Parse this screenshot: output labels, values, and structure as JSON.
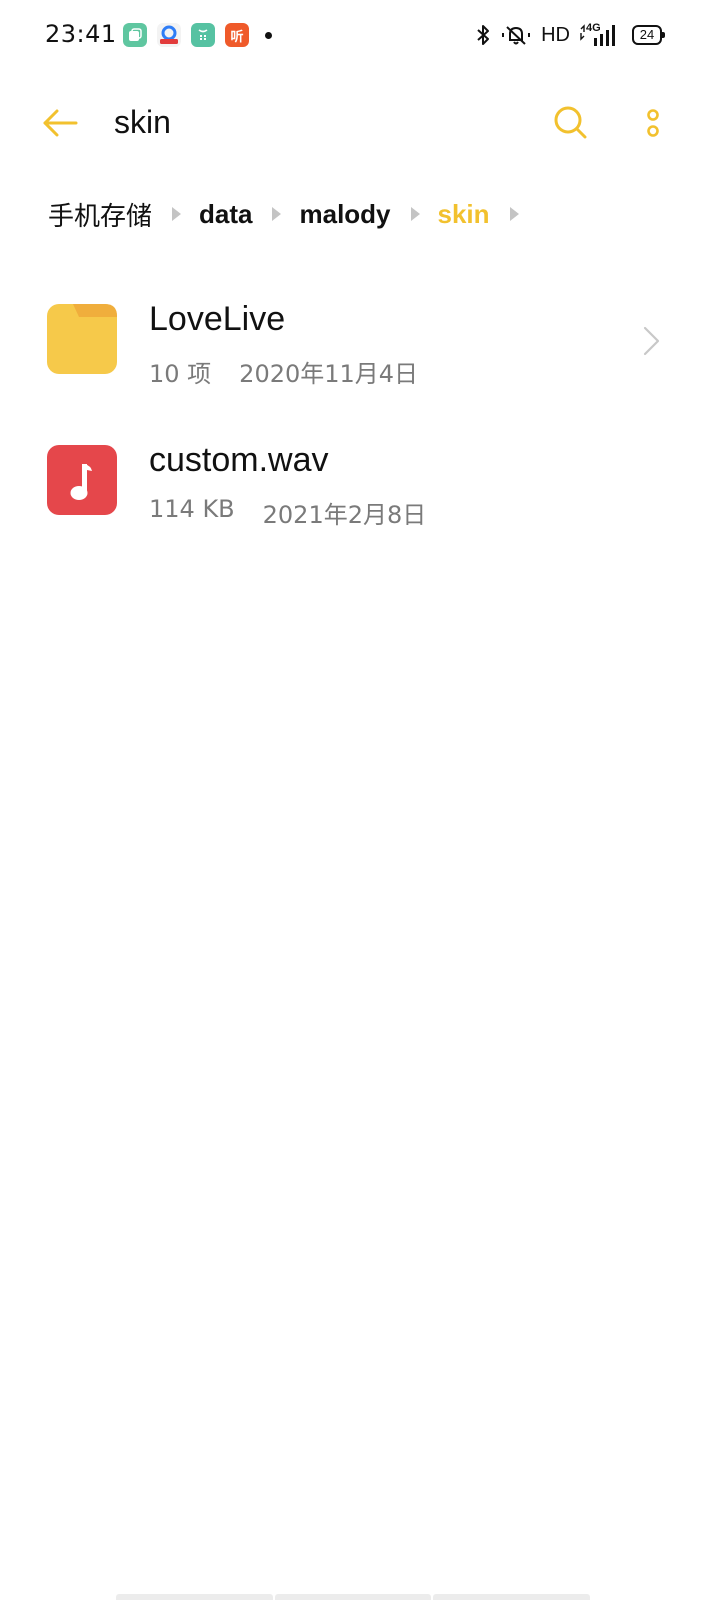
{
  "status_bar": {
    "time": "23:41",
    "notification_icons": [
      "app-notification-icon-green",
      "app-notification-icon-baidu",
      "app-notification-icon-teal",
      "app-notification-icon-listen"
    ],
    "listen_icon_text": "听",
    "hd_label": "HD",
    "network_label": "4G",
    "battery_level": "24"
  },
  "toolbar": {
    "title": "skin",
    "back_icon": "arrow-left-icon",
    "search_icon": "search-icon",
    "more_icon": "more-vertical-icon"
  },
  "breadcrumb": [
    {
      "label": "手机存储"
    },
    {
      "label": "data"
    },
    {
      "label": "malody"
    },
    {
      "label": "skin",
      "active": true
    }
  ],
  "files": [
    {
      "name": "LoveLive",
      "type": "folder",
      "info": "10 项",
      "date": "2020年11月4日",
      "icon": "folder-icon"
    },
    {
      "name": "custom.wav",
      "type": "audio",
      "info": "114 KB",
      "date": "2021年2月8日",
      "icon": "music-file-icon"
    }
  ],
  "colors": {
    "accent": "#F2C12E",
    "folder": "#F6C94A",
    "folder_tab": "#F0AE3C",
    "audio": "#E5474B",
    "meta_text": "#7A7A7A"
  }
}
